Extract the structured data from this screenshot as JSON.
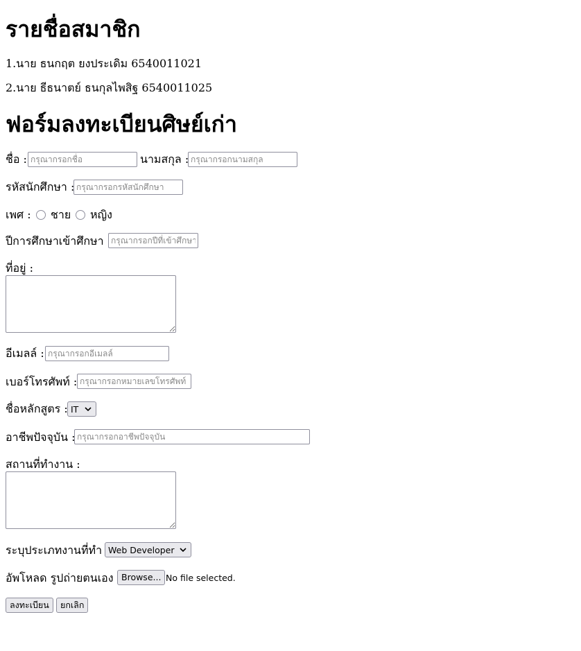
{
  "members": {
    "title": "รายชื่อสมาชิก",
    "list": [
      "1.นาย ธนกฤต ยงประเดิม 6540011021",
      "2.นาย ธีธนาตย์ ธนกุลไพสิฐ 6540011025"
    ]
  },
  "form": {
    "title": "ฟอร์มลงทะเบียนศิษย์เก่า",
    "first_name": {
      "label": "ชื่อ :",
      "placeholder": "กรุณากรอกชื่อ",
      "value": ""
    },
    "last_name": {
      "label": "นามสกุล :",
      "placeholder": "กรุณากรอกนามสกุล",
      "value": ""
    },
    "student_id": {
      "label": "รหัสนักศึกษา :",
      "placeholder": "กรุณากรอกรหัสนักศึกษา",
      "value": ""
    },
    "gender": {
      "label": "เพศ :",
      "options": [
        "ชาย",
        "หญิง"
      ]
    },
    "entry_year": {
      "label": "ปีการศึกษาเข้าศึกษา :",
      "placeholder": "กรุณากรอกปีที่เข้าศึกษา",
      "value": ""
    },
    "address": {
      "label": "ที่อยู่ :",
      "value": ""
    },
    "email": {
      "label": "อีเมลล์ :",
      "placeholder": "กรุณากรอกอีเมลล์",
      "value": ""
    },
    "phone": {
      "label": "เบอร์โทรศัพท์ :",
      "placeholder": "กรุณากรอกหมายเลขโทรศัพท์",
      "value": ""
    },
    "course": {
      "label": "ชื่อหลักสูตร :",
      "selected": "IT"
    },
    "occupation": {
      "label": "อาชีพปัจจุบัน :",
      "placeholder": "กรุณากรอกอาชีพปัจจุบัน",
      "value": ""
    },
    "workplace": {
      "label": "สถานที่ทำงาน :",
      "value": ""
    },
    "job_type": {
      "label": "ระบุประเภทงานที่ทำ :",
      "selected": "Web Developer"
    },
    "photo": {
      "label": "อัพโหลด รูปถ่ายตนเอง :",
      "button": "Browse...",
      "status": "No file selected."
    },
    "submit_label": "ลงทะเบียน",
    "cancel_label": "ยกเลิก"
  },
  "icons": {
    "select_arrow": "chevron-down-icon",
    "resize_grip": "resize-grip-icon"
  }
}
